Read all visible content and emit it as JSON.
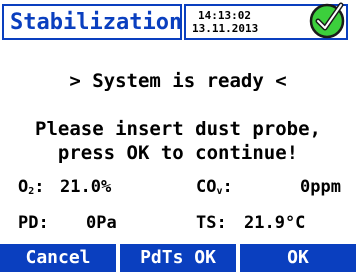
{
  "header": {
    "title": "Stabilization",
    "time": "14:13:02",
    "date": "13.11.2013",
    "status_icon": "check-circle-icon",
    "accent_color": "#0a3fbf",
    "status_color": "#2fbf2f"
  },
  "messages": {
    "status": "> System is ready <",
    "instruction_line1": "Please insert dust probe,",
    "instruction_line2": "press OK to continue!"
  },
  "readings": {
    "o2_label_main": "O",
    "o2_label_sub": "2",
    "o2_label_suffix": ":",
    "o2_value": "21.0%",
    "co_label_main": "CO",
    "co_label_sub": "v",
    "co_label_suffix": ":",
    "co_value": "0ppm",
    "pd_label": "PD:",
    "pd_value": "0Pa",
    "ts_label": "TS:",
    "ts_value": "21.9°C"
  },
  "buttons": {
    "cancel": "Cancel",
    "pdts_ok": "PdTs OK",
    "ok": "OK"
  }
}
